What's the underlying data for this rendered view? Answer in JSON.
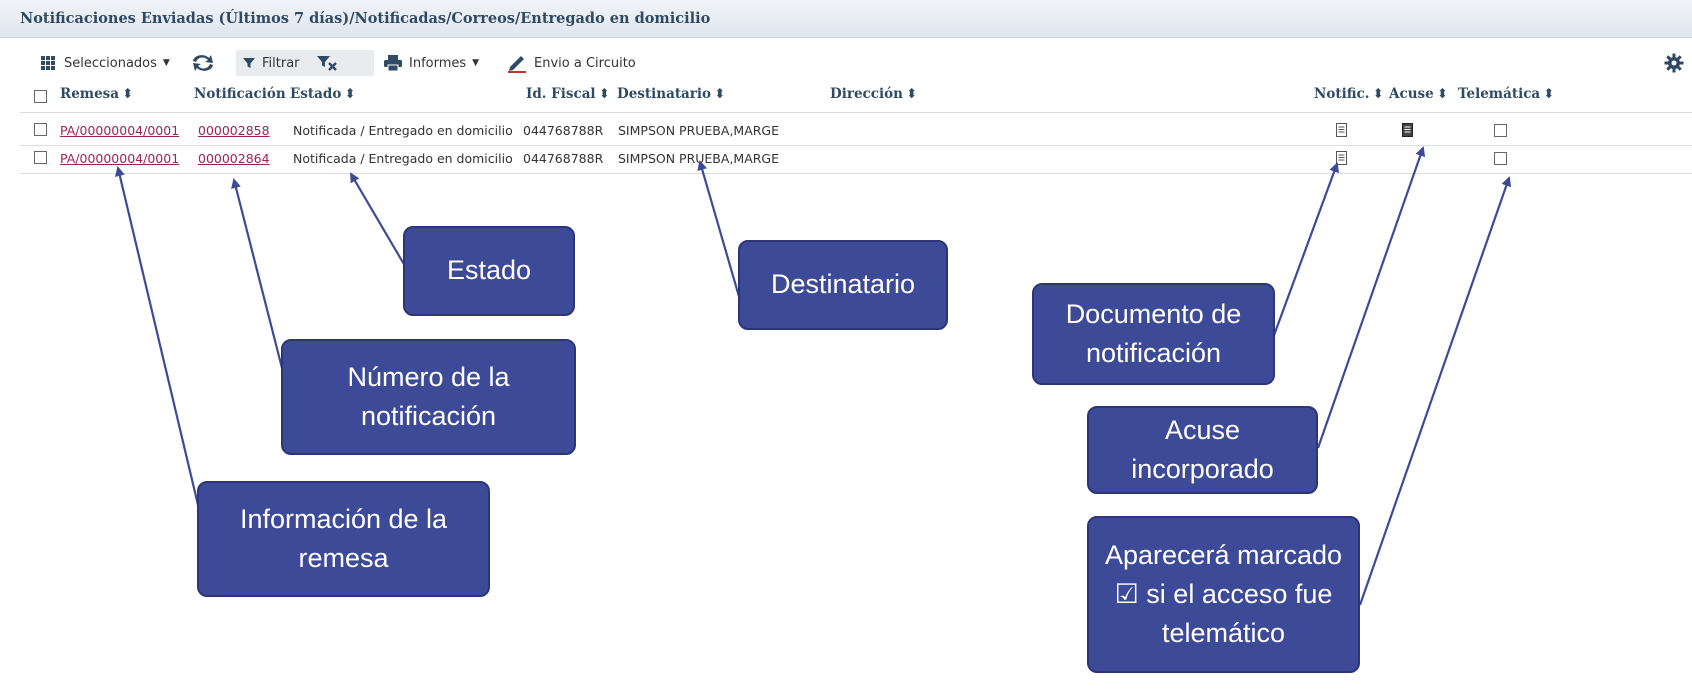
{
  "breadcrumb": "Notificaciones Enviadas (Últimos 7 días)/Notificadas/Correos/Entregado en domicilio",
  "toolbar": {
    "selected_label": "Seleccionados",
    "filter_label": "Filtrar",
    "reports_label": "Informes",
    "send_label": "Envio a Circuito"
  },
  "table": {
    "columns": {
      "remesa": "Remesa",
      "notificacion": "Notificación",
      "estado": "Estado",
      "id_fiscal": "Id. Fiscal",
      "destinatario": "Destinatario",
      "direccion": "Dirección",
      "notific": "Notific.",
      "acuse": "Acuse",
      "telematica": "Telemática"
    },
    "rows": [
      {
        "remesa": "PA/00000004/0001",
        "notificacion": "000002858",
        "estado": "Notificada / Entregado en domicilio",
        "id_fiscal": "044768788R",
        "destinatario": "SIMPSON PRUEBA,MARGE",
        "direccion": "",
        "acuse_incorporado": true,
        "telematica": false
      },
      {
        "remesa": "PA/00000004/0001",
        "notificacion": "000002864",
        "estado": "Notificada / Entregado en domicilio",
        "id_fiscal": "044768788R",
        "destinatario": "SIMPSON PRUEBA,MARGE",
        "direccion": "",
        "acuse_incorporado": false,
        "telematica": false
      }
    ]
  },
  "callouts": {
    "estado": "Estado",
    "destinatario": "Destinatario",
    "numero": "Número de la\nnotificación",
    "remesa": "Información de la\nremesa",
    "documento": "Documento de\nnotificación",
    "acuse": "Acuse\nincorporado",
    "telematico": "Aparecerá marcado\n☑ si el acceso fue\ntelemático"
  },
  "colors": {
    "callout_bg": "#3d4a97",
    "link": "#a0225a",
    "header_text": "#2f4a63",
    "arrow": "#3d4a97"
  }
}
